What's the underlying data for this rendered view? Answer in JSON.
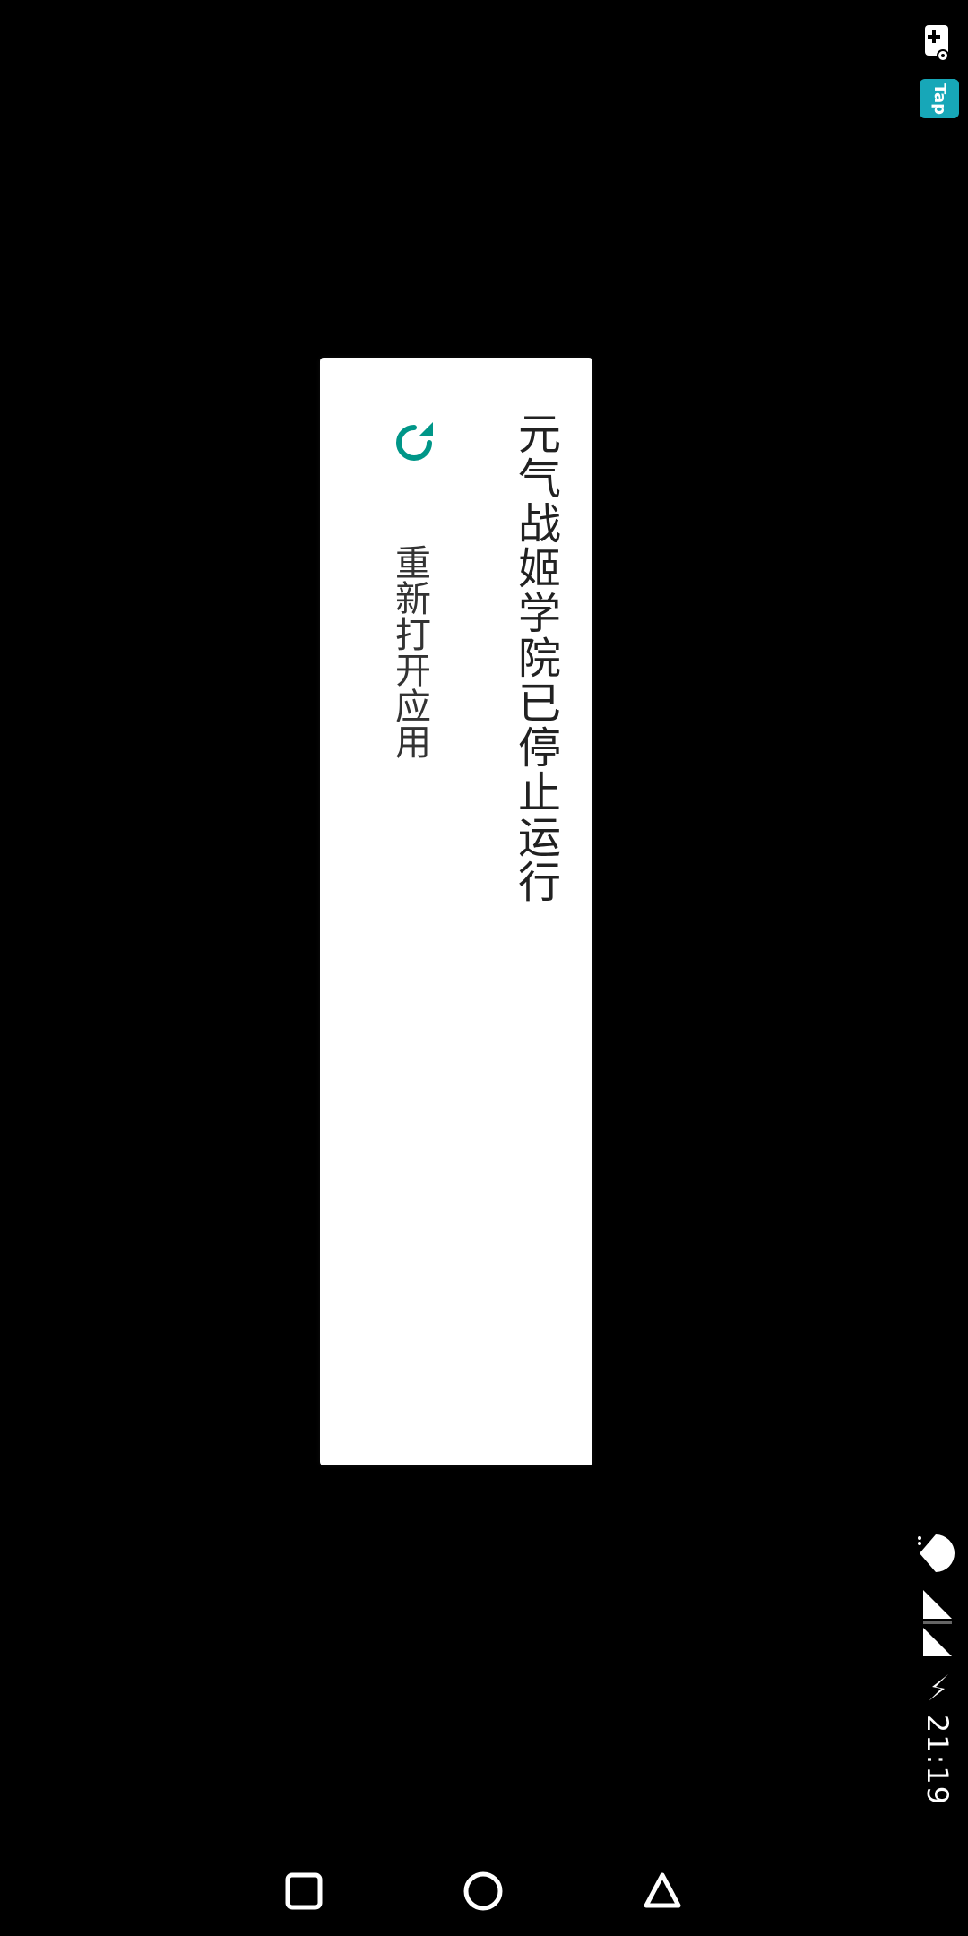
{
  "status_bar": {
    "tap_badge": "Tap",
    "time": "21:19",
    "icons": [
      "gamepad-plus-icon",
      "tap-badge-icon",
      "wifi-icon",
      "signal-icon",
      "signal-icon",
      "charging-icon"
    ]
  },
  "dialog": {
    "title": "元气战姬学院已停止运行",
    "action_label": "重新打开应用",
    "action_icon": "refresh-icon",
    "accent_color": "#009688"
  },
  "nav_bar": {
    "buttons": [
      "recents-icon",
      "home-icon",
      "back-icon"
    ]
  }
}
